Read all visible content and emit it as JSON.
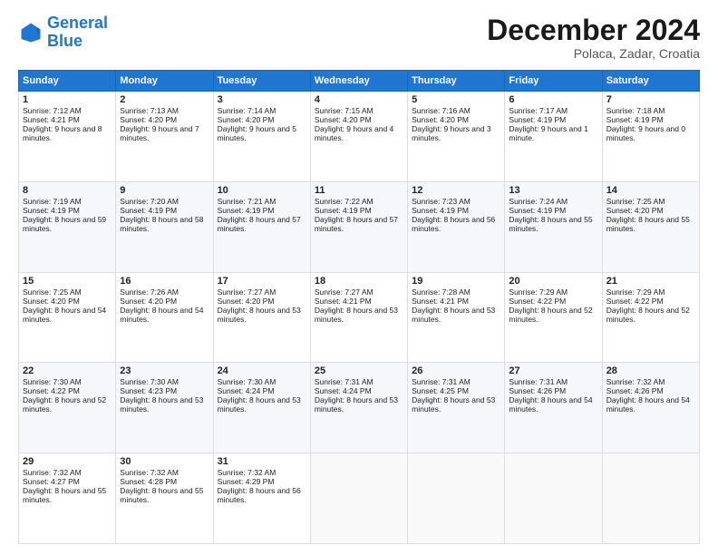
{
  "header": {
    "logo_line1": "General",
    "logo_line2": "Blue",
    "title": "December 2024",
    "subtitle": "Polaca, Zadar, Croatia"
  },
  "weekdays": [
    "Sunday",
    "Monday",
    "Tuesday",
    "Wednesday",
    "Thursday",
    "Friday",
    "Saturday"
  ],
  "weeks": [
    [
      {
        "day": "1",
        "sunrise": "7:12 AM",
        "sunset": "4:21 PM",
        "daylight": "9 hours and 8 minutes."
      },
      {
        "day": "2",
        "sunrise": "7:13 AM",
        "sunset": "4:20 PM",
        "daylight": "9 hours and 7 minutes."
      },
      {
        "day": "3",
        "sunrise": "7:14 AM",
        "sunset": "4:20 PM",
        "daylight": "9 hours and 5 minutes."
      },
      {
        "day": "4",
        "sunrise": "7:15 AM",
        "sunset": "4:20 PM",
        "daylight": "9 hours and 4 minutes."
      },
      {
        "day": "5",
        "sunrise": "7:16 AM",
        "sunset": "4:20 PM",
        "daylight": "9 hours and 3 minutes."
      },
      {
        "day": "6",
        "sunrise": "7:17 AM",
        "sunset": "4:19 PM",
        "daylight": "9 hours and 1 minute."
      },
      {
        "day": "7",
        "sunrise": "7:18 AM",
        "sunset": "4:19 PM",
        "daylight": "9 hours and 0 minutes."
      }
    ],
    [
      {
        "day": "8",
        "sunrise": "7:19 AM",
        "sunset": "4:19 PM",
        "daylight": "8 hours and 59 minutes."
      },
      {
        "day": "9",
        "sunrise": "7:20 AM",
        "sunset": "4:19 PM",
        "daylight": "8 hours and 58 minutes."
      },
      {
        "day": "10",
        "sunrise": "7:21 AM",
        "sunset": "4:19 PM",
        "daylight": "8 hours and 57 minutes."
      },
      {
        "day": "11",
        "sunrise": "7:22 AM",
        "sunset": "4:19 PM",
        "daylight": "8 hours and 57 minutes."
      },
      {
        "day": "12",
        "sunrise": "7:23 AM",
        "sunset": "4:19 PM",
        "daylight": "8 hours and 56 minutes."
      },
      {
        "day": "13",
        "sunrise": "7:24 AM",
        "sunset": "4:19 PM",
        "daylight": "8 hours and 55 minutes."
      },
      {
        "day": "14",
        "sunrise": "7:25 AM",
        "sunset": "4:20 PM",
        "daylight": "8 hours and 55 minutes."
      }
    ],
    [
      {
        "day": "15",
        "sunrise": "7:25 AM",
        "sunset": "4:20 PM",
        "daylight": "8 hours and 54 minutes."
      },
      {
        "day": "16",
        "sunrise": "7:26 AM",
        "sunset": "4:20 PM",
        "daylight": "8 hours and 54 minutes."
      },
      {
        "day": "17",
        "sunrise": "7:27 AM",
        "sunset": "4:20 PM",
        "daylight": "8 hours and 53 minutes."
      },
      {
        "day": "18",
        "sunrise": "7:27 AM",
        "sunset": "4:21 PM",
        "daylight": "8 hours and 53 minutes."
      },
      {
        "day": "19",
        "sunrise": "7:28 AM",
        "sunset": "4:21 PM",
        "daylight": "8 hours and 53 minutes."
      },
      {
        "day": "20",
        "sunrise": "7:29 AM",
        "sunset": "4:22 PM",
        "daylight": "8 hours and 52 minutes."
      },
      {
        "day": "21",
        "sunrise": "7:29 AM",
        "sunset": "4:22 PM",
        "daylight": "8 hours and 52 minutes."
      }
    ],
    [
      {
        "day": "22",
        "sunrise": "7:30 AM",
        "sunset": "4:22 PM",
        "daylight": "8 hours and 52 minutes."
      },
      {
        "day": "23",
        "sunrise": "7:30 AM",
        "sunset": "4:23 PM",
        "daylight": "8 hours and 53 minutes."
      },
      {
        "day": "24",
        "sunrise": "7:30 AM",
        "sunset": "4:24 PM",
        "daylight": "8 hours and 53 minutes."
      },
      {
        "day": "25",
        "sunrise": "7:31 AM",
        "sunset": "4:24 PM",
        "daylight": "8 hours and 53 minutes."
      },
      {
        "day": "26",
        "sunrise": "7:31 AM",
        "sunset": "4:25 PM",
        "daylight": "8 hours and 53 minutes."
      },
      {
        "day": "27",
        "sunrise": "7:31 AM",
        "sunset": "4:26 PM",
        "daylight": "8 hours and 54 minutes."
      },
      {
        "day": "28",
        "sunrise": "7:32 AM",
        "sunset": "4:26 PM",
        "daylight": "8 hours and 54 minutes."
      }
    ],
    [
      {
        "day": "29",
        "sunrise": "7:32 AM",
        "sunset": "4:27 PM",
        "daylight": "8 hours and 55 minutes."
      },
      {
        "day": "30",
        "sunrise": "7:32 AM",
        "sunset": "4:28 PM",
        "daylight": "8 hours and 55 minutes."
      },
      {
        "day": "31",
        "sunrise": "7:32 AM",
        "sunset": "4:29 PM",
        "daylight": "8 hours and 56 minutes."
      },
      null,
      null,
      null,
      null
    ]
  ]
}
